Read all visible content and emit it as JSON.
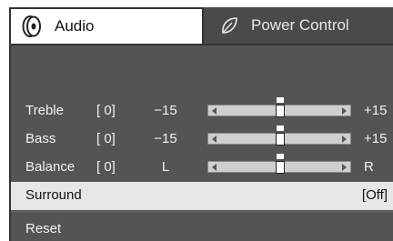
{
  "tabs": [
    {
      "label": "Audio",
      "icon": "speaker-icon",
      "active": true
    },
    {
      "label": "Power Control",
      "icon": "leaf-icon",
      "active": false
    }
  ],
  "sliders": [
    {
      "label": "Treble",
      "value": "[ 0]",
      "min_label": "−15",
      "max_label": "+15",
      "level": 0.5
    },
    {
      "label": "Bass",
      "value": "[ 0]",
      "min_label": "−15",
      "max_label": "+15",
      "level": 0.5
    },
    {
      "label": "Balance",
      "value": "[ 0]",
      "min_label": "L",
      "max_label": "R",
      "level": 0.5
    }
  ],
  "surround": {
    "label": "Surround",
    "state": "[Off]"
  },
  "reset": {
    "label": "Reset"
  },
  "colors": {
    "panel": "#545454",
    "highlight": "#e6e6e6",
    "tab_inactive": "#4a4a4a"
  }
}
